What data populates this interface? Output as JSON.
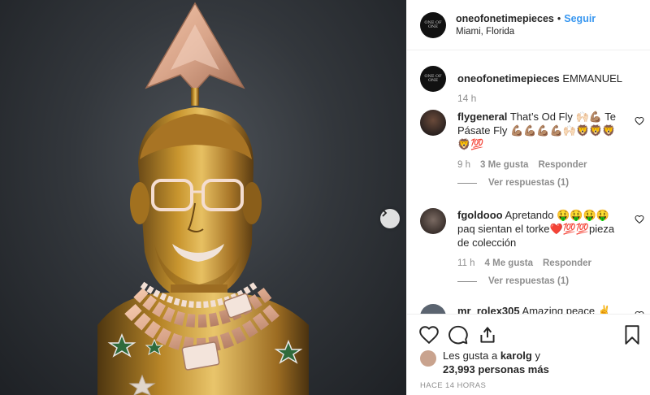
{
  "post": {
    "username": "oneofonetimepieces",
    "dot": "•",
    "follow_label": "Seguir",
    "location": "Miami, Florida",
    "avatar_text": "ONE OF ONE"
  },
  "caption": {
    "username": "oneofonetimepieces",
    "text": "EMMANUEL",
    "time": "14 h"
  },
  "comments": [
    {
      "username": "flygeneral",
      "text": "That’s Od Fly 🙌🏻💪🏽 Te Pásate Fly 💪🏽💪🏽💪🏽💪🏽🙌🏻🦁🦁🦁🦁💯",
      "time": "9 h",
      "likes": "3 Me gusta",
      "reply": "Responder",
      "replies": "Ver respuestas (1)"
    },
    {
      "username": "fgoldooo",
      "text": "Apretando 🤑🤑🤑🤑 paq sientan el torke❤️💯💯pieza de colección",
      "time": "11 h",
      "likes": "4 Me gusta",
      "reply": "Responder",
      "replies": "Ver respuestas (1)"
    },
    {
      "username": "mr_rolex305",
      "text": "Amazing peace ✌️"
    }
  ],
  "actions": {
    "like_icon": "heart-icon",
    "comment_icon": "comment-icon",
    "share_icon": "share-icon",
    "save_icon": "bookmark-icon"
  },
  "likes": {
    "prefix": "Les gusta a ",
    "user": "karolg",
    "middle": " y",
    "count": "23,993 personas más"
  },
  "time_ago": "HACE 14 HORAS",
  "colors": {
    "link": "#3897f0",
    "muted": "#8e8e8e",
    "gold": "#c9962f",
    "rose_gold": "#d9a58a"
  }
}
